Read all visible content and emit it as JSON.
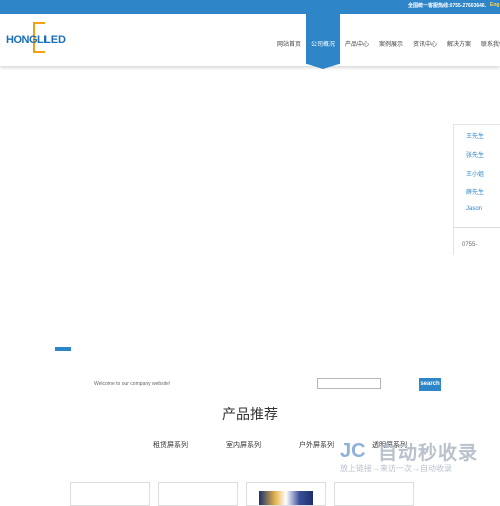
{
  "topbar": {
    "hotline": "全国统一客服热线:0755-27603646.",
    "lang": "Eng"
  },
  "logo": {
    "text_left": "HONGLI",
    "text_right": "LED"
  },
  "nav": {
    "items": [
      {
        "label": "网站首页"
      },
      {
        "label": "公司概况"
      },
      {
        "label": "产品中心"
      },
      {
        "label": "案例展示"
      },
      {
        "label": "资讯中心"
      },
      {
        "label": "解决方案"
      },
      {
        "label": "联系我们"
      }
    ],
    "active_index": 1
  },
  "side_contacts": {
    "names": [
      "王先生",
      "张先生",
      "王小姐",
      "薛先生",
      "Jason"
    ],
    "phone": "0755-"
  },
  "welcome": "Welcome to our company website!",
  "search": {
    "placeholder": "",
    "button": "search"
  },
  "section_title": "产品推荐",
  "categories": [
    "租赁屏系列",
    "室内屏系列",
    "户外屏系列",
    "透明屏系列"
  ],
  "watermark": {
    "mark": "JC",
    "title": "自动秒收录",
    "subtitle": "放上链接→来访一次→自动收录"
  },
  "colors": {
    "accent": "#2e86c9",
    "logo_orange": "#f2a014",
    "text": "#333333"
  }
}
